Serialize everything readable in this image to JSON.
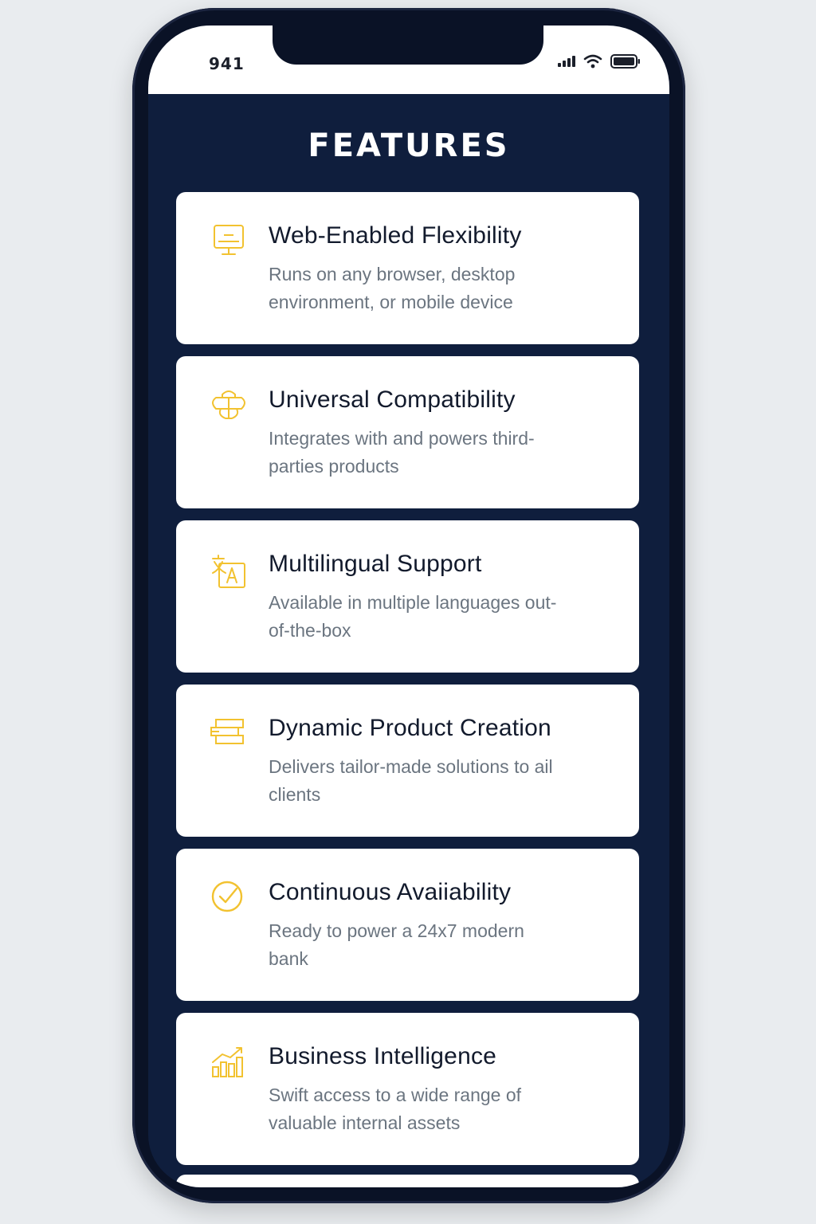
{
  "status_bar": {
    "time": "941"
  },
  "page": {
    "title": "FEATURES"
  },
  "colors": {
    "background": "#0f1e3d",
    "card": "#ffffff",
    "accent_icon": "#f2c230",
    "title_text": "#121a2c",
    "desc_text": "#6b7580"
  },
  "features": [
    {
      "icon": "monitor-icon",
      "title": "Web-Enabled Flexibility",
      "description": "Runs on any browser, desktop environment, or mobile device"
    },
    {
      "icon": "integration-icon",
      "title": "Universal Compatibility",
      "description": "Integrates with and powers third-parties products"
    },
    {
      "icon": "translate-icon",
      "title": "Multilingual Support",
      "description": "Available in multiple languages out-of-the-box"
    },
    {
      "icon": "layers-icon",
      "title": "Dynamic Product Creation",
      "description": "Delivers tailor-made solutions to ail clients"
    },
    {
      "icon": "check-circle-icon",
      "title": "Continuous Avaiiability",
      "description": "Ready to power a 24x7 modern bank"
    },
    {
      "icon": "growth-chart-icon",
      "title": "Business Intelligence",
      "description": "Swift access to a wide range of valuable internal assets"
    }
  ]
}
